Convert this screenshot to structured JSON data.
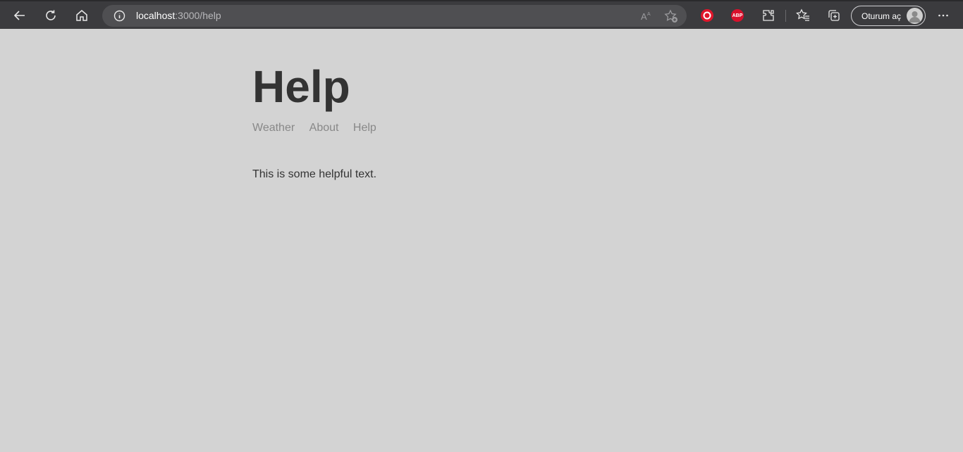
{
  "browser": {
    "url_host": "localhost",
    "url_rest": ":3000/help",
    "signin_label": "Oturum aç",
    "abp_label": "ABP",
    "icons": [
      "back-icon",
      "refresh-icon",
      "home-icon",
      "info-icon",
      "read-aloud-icon",
      "add-favorite-icon",
      "extension-red-icon",
      "adblock-plus-icon",
      "extensions-icon",
      "favorites-icon",
      "collections-icon",
      "more-icon"
    ]
  },
  "page": {
    "title": "Help",
    "nav": [
      {
        "label": "Weather"
      },
      {
        "label": "About"
      },
      {
        "label": "Help"
      }
    ],
    "body_text": "This is some helpful text."
  },
  "colors": {
    "page_bg": "#d3d3d3",
    "toolbar_bg": "#3b3b3e",
    "title": "#333333",
    "nav_link": "#888888"
  }
}
